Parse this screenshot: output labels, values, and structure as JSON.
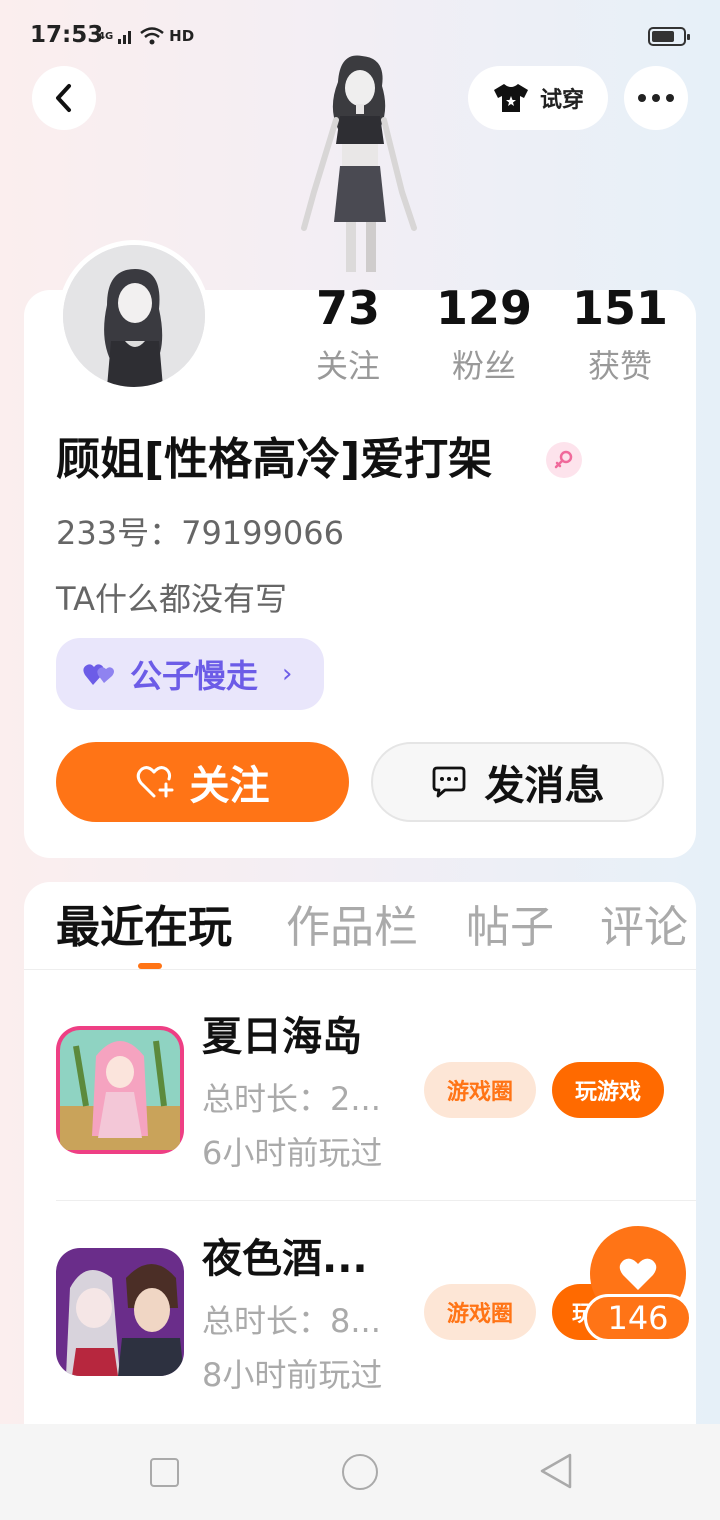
{
  "status_bar": {
    "time": "17:53",
    "network": "4G",
    "hd": "HD"
  },
  "top_bar": {
    "try_on_label": "试穿"
  },
  "stats": [
    {
      "value": "73",
      "label": "关注"
    },
    {
      "value": "129",
      "label": "粉丝"
    },
    {
      "value": "151",
      "label": "获赞"
    }
  ],
  "profile": {
    "username": "顾姐[性格高冷]爱打架",
    "gender": "female",
    "uid": "233号：79199066",
    "bio": "TA什么都没有写",
    "relation_label": "公子慢走"
  },
  "actions": {
    "follow_label": "关注",
    "message_label": "发消息"
  },
  "tabs": [
    {
      "label": "最近在玩",
      "active": true
    },
    {
      "label": "作品栏",
      "active": false
    },
    {
      "label": "帖子",
      "active": false
    },
    {
      "label": "评论",
      "active": false
    }
  ],
  "games": [
    {
      "title": "夏日海岛",
      "duration": "总时长：2...",
      "last_played": "6小时前玩过",
      "circle_label": "游戏圈",
      "play_label": "玩游戏"
    },
    {
      "title": "夜色酒...",
      "duration": "总时长：8...",
      "last_played": "8小时前玩过",
      "circle_label": "游戏圈",
      "play_label": "玩"
    }
  ],
  "like_float": {
    "count": "146"
  },
  "colors": {
    "accent": "#ff7416",
    "relation": "#6c5ce7"
  }
}
